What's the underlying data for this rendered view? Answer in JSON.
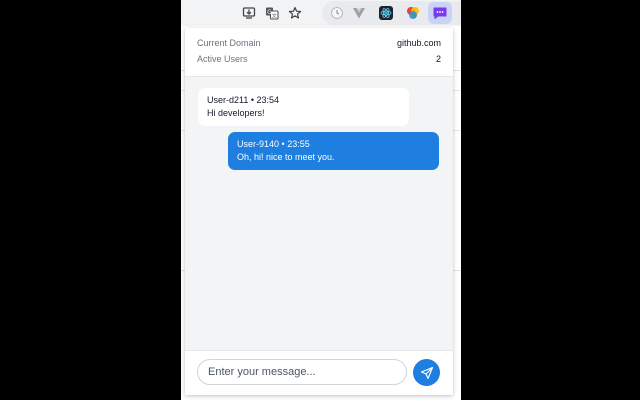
{
  "info": {
    "domain_label": "Current Domain",
    "domain_value": "github.com",
    "users_label": "Active Users",
    "users_value": "2"
  },
  "messages": [
    {
      "author": "User-d211",
      "time": "23:54",
      "text": "Hi developers!"
    },
    {
      "author": "User-9140",
      "time": "23:55",
      "text": "Oh, hi! nice to meet you."
    }
  ],
  "composer": {
    "placeholder": "Enter your message..."
  },
  "icons": {
    "toolbar": [
      "install-app-icon",
      "translate-icon",
      "bookmark-star-icon"
    ],
    "extensions": [
      "extension-clock-icon",
      "extension-vue-icon",
      "extension-react-icon",
      "extension-color-icon",
      "extension-chat-icon"
    ],
    "send": "send-icon"
  },
  "colors": {
    "accent": "#1e7fe0",
    "popup_bg": "#f3f4f6"
  }
}
